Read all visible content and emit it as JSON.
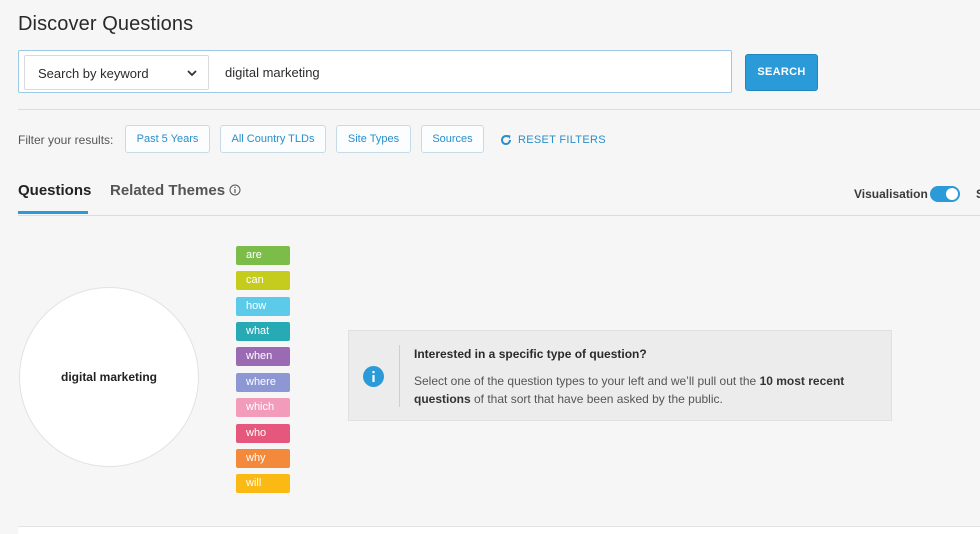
{
  "header": {
    "title": "Discover Questions"
  },
  "search": {
    "mode_label": "Search by keyword",
    "query": "digital marketing",
    "button_label": "SEARCH"
  },
  "filters": {
    "label": "Filter your results:",
    "chips": [
      {
        "label": "Past 5 Years"
      },
      {
        "label": "All Country TLDs"
      },
      {
        "label": "Site Types"
      },
      {
        "label": "Sources"
      }
    ],
    "reset_label": "RESET FILTERS"
  },
  "tabs": {
    "questions": "Questions",
    "related_themes": "Related Themes",
    "active": "Questions"
  },
  "visualisation": {
    "label": "Visualisation",
    "enabled": true,
    "truncated_next_label": "S"
  },
  "keyword_circle": {
    "text": "digital marketing"
  },
  "question_types": [
    {
      "label": "are",
      "color": "#7cbd4a"
    },
    {
      "label": "can",
      "color": "#c6cc1d"
    },
    {
      "label": "how",
      "color": "#5ccbea"
    },
    {
      "label": "what",
      "color": "#27aab4"
    },
    {
      "label": "when",
      "color": "#9a6bb2"
    },
    {
      "label": "where",
      "color": "#8c97d4"
    },
    {
      "label": "which",
      "color": "#f39bbb"
    },
    {
      "label": "who",
      "color": "#e5577c"
    },
    {
      "label": "why",
      "color": "#f2893b"
    },
    {
      "label": "will",
      "color": "#fbb914"
    }
  ],
  "info_panel": {
    "heading": "Interested in a specific type of question?",
    "body_prefix": "Select one of the question types to your left and we’ll pull out the ",
    "body_bold": "10 most recent questions",
    "body_suffix": " of that sort that have been asked by the public."
  },
  "colors": {
    "accent": "#2a9bd8",
    "link": "#2a8fc9"
  }
}
